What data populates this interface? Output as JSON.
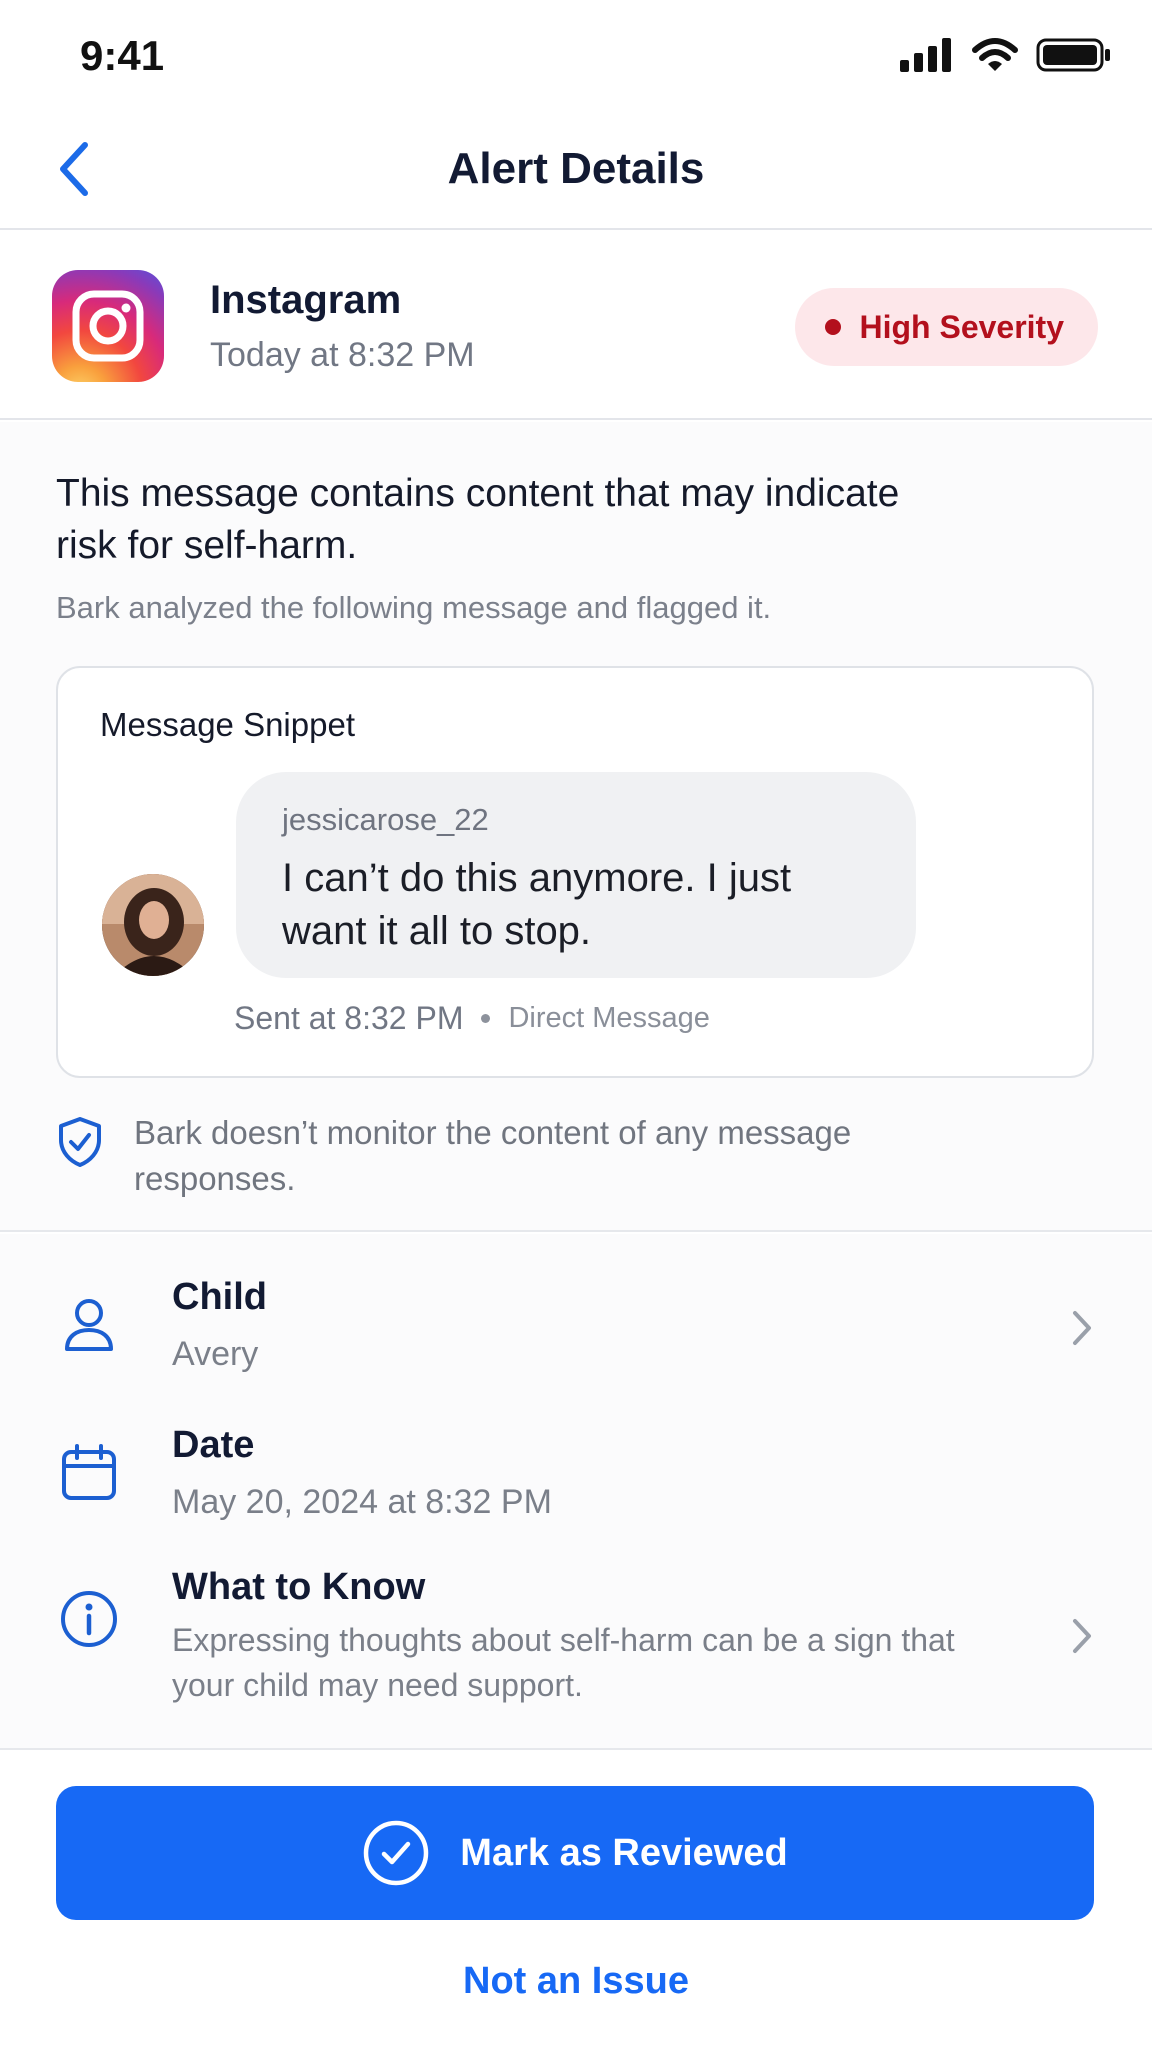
{
  "status_bar": {
    "time": "9:41",
    "icons": [
      "signal-icon",
      "wifi-icon",
      "battery-icon"
    ]
  },
  "nav": {
    "title": "Alert Details",
    "back_icon": "chevron-left-icon"
  },
  "alert": {
    "app_name": "Instagram",
    "time": "Today at 8:32 PM",
    "severity": "High Severity",
    "headline": "This message contains content that may indicate risk for self-harm.",
    "subline": "Bark analyzed the following message and flagged it."
  },
  "snippet": {
    "title": "Message Snippet",
    "username": "jessicarose_22",
    "message": "I can’t do this anymore. I just want it all to stop.",
    "sent": "Sent at 8:32 PM",
    "type": "Direct Message"
  },
  "privacy_note": "Bark doesn’t monitor the content of any message responses.",
  "details": [
    {
      "title": "Child",
      "value": "Avery",
      "icon": "user-icon",
      "chevron": true
    },
    {
      "title": "Date",
      "value": "May 20, 2024 at 8:32 PM",
      "icon": "calendar-icon",
      "chevron": false
    },
    {
      "title": "What to Know",
      "value": "Expressing thoughts about self-harm can be a sign that your child may need support.",
      "icon": "info-icon",
      "chevron": true
    }
  ],
  "actions": {
    "primary": "Mark as Reviewed",
    "secondary": "Not an Issue"
  },
  "colors": {
    "accent": "#1769f5",
    "severity": "#b3101d",
    "severity_bg": "#fde7ea",
    "icon_blue": "#1c5fd1"
  }
}
